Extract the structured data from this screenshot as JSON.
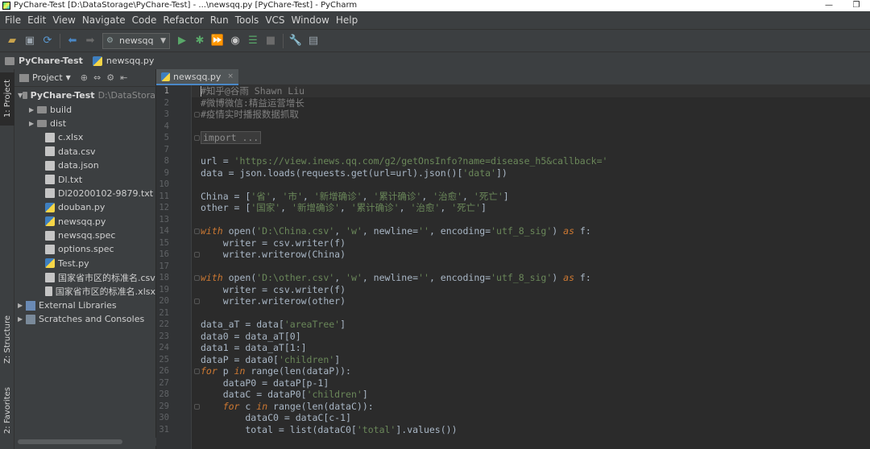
{
  "window": {
    "title": "PyChare-Test [D:\\DataStorage\\PyChare-Test] - ...\\newsqq.py [PyChare-Test] - PyCharm",
    "minimize_glyph": "—",
    "restore_glyph": "❐"
  },
  "menu": [
    "File",
    "Edit",
    "View",
    "Navigate",
    "Code",
    "Refactor",
    "Run",
    "Tools",
    "VCS",
    "Window",
    "Help"
  ],
  "toolbar": {
    "run_config": "newsqq",
    "icons": [
      "open-folder-icon",
      "save-icon",
      "sync-icon",
      "back-icon",
      "forward-icon",
      "run-icon",
      "debug-icon",
      "run-coverage-icon",
      "profile-icon",
      "concurrency-icon",
      "stop-icon",
      "settings-icon",
      "structure-icon"
    ]
  },
  "navbar": {
    "project": "PyChare-Test",
    "file": "newsqq.py"
  },
  "left_tabs": {
    "project": "1: Project",
    "structure": "Z: Structure",
    "favorites": "2: Favorites"
  },
  "project_panel": {
    "view_label": "Project",
    "root": {
      "name": "PyChare-Test",
      "path": "D:\\DataStora"
    },
    "items": [
      {
        "name": "build",
        "type": "folder"
      },
      {
        "name": "dist",
        "type": "folder"
      },
      {
        "name": "c.xlsx",
        "type": "file"
      },
      {
        "name": "data.csv",
        "type": "file"
      },
      {
        "name": "data.json",
        "type": "file"
      },
      {
        "name": "Dl.txt",
        "type": "file"
      },
      {
        "name": "Dl20200102-9879.txt",
        "type": "file"
      },
      {
        "name": "douban.py",
        "type": "py"
      },
      {
        "name": "newsqq.py",
        "type": "py"
      },
      {
        "name": "newsqq.spec",
        "type": "file"
      },
      {
        "name": "options.spec",
        "type": "file"
      },
      {
        "name": "Test.py",
        "type": "py"
      },
      {
        "name": "国家省市区的标准名.csv",
        "type": "file"
      },
      {
        "name": "国家省市区的标准名.xlsx",
        "type": "file"
      }
    ],
    "external_libraries": "External Libraries",
    "scratches": "Scratches and Consoles"
  },
  "tab": {
    "label": "newsqq.py",
    "close": "×"
  },
  "code": [
    {
      "n": "1",
      "tokens": [
        [
          "cmt",
          "#知乎@谷雨 Shawn Liu"
        ]
      ]
    },
    {
      "n": "2",
      "tokens": [
        [
          "cmt",
          "#微博微信:精益运营增长"
        ]
      ]
    },
    {
      "n": "3",
      "tokens": [
        [
          "cmt",
          "#疫情实时播报数据抓取"
        ]
      ]
    },
    {
      "n": "4",
      "tokens": []
    },
    {
      "n": "5",
      "tokens": [
        [
          "fold",
          "import ..."
        ]
      ]
    },
    {
      "n": "7",
      "tokens": []
    },
    {
      "n": "8",
      "tokens": [
        [
          "txt",
          "url = "
        ],
        [
          "str",
          "'https://view.inews.qq.com/g2/getOnsInfo?name=disease_h5&callback='"
        ]
      ]
    },
    {
      "n": "9",
      "tokens": [
        [
          "txt",
          "data = json.loads(requests.get(url=url).json()["
        ],
        [
          "str",
          "'data'"
        ],
        [
          "txt",
          "])"
        ]
      ]
    },
    {
      "n": "10",
      "tokens": []
    },
    {
      "n": "11",
      "tokens": [
        [
          "txt",
          "China = ["
        ],
        [
          "str",
          "'省'"
        ],
        [
          "txt",
          ", "
        ],
        [
          "str",
          "'市'"
        ],
        [
          "txt",
          ", "
        ],
        [
          "str",
          "'新增确诊'"
        ],
        [
          "txt",
          ", "
        ],
        [
          "str",
          "'累计确诊'"
        ],
        [
          "txt",
          ", "
        ],
        [
          "str",
          "'治愈'"
        ],
        [
          "txt",
          ", "
        ],
        [
          "str",
          "'死亡'"
        ],
        [
          "txt",
          "]"
        ]
      ]
    },
    {
      "n": "12",
      "tokens": [
        [
          "txt",
          "other = ["
        ],
        [
          "str",
          "'国家'"
        ],
        [
          "txt",
          ", "
        ],
        [
          "str",
          "'新增确诊'"
        ],
        [
          "txt",
          ", "
        ],
        [
          "str",
          "'累计确诊'"
        ],
        [
          "txt",
          ", "
        ],
        [
          "str",
          "'治愈'"
        ],
        [
          "txt",
          ", "
        ],
        [
          "str",
          "'死亡'"
        ],
        [
          "txt",
          "]"
        ]
      ]
    },
    {
      "n": "13",
      "tokens": []
    },
    {
      "n": "14",
      "tokens": [
        [
          "kw",
          "with"
        ],
        [
          "txt",
          " open("
        ],
        [
          "str",
          "'D:\\China.csv'"
        ],
        [
          "txt",
          ", "
        ],
        [
          "str",
          "'w'"
        ],
        [
          "txt",
          ", newline="
        ],
        [
          "str",
          "''"
        ],
        [
          "txt",
          ", encoding="
        ],
        [
          "str",
          "'utf_8_sig'"
        ],
        [
          "txt",
          ") "
        ],
        [
          "kw",
          "as"
        ],
        [
          "txt",
          " f:"
        ]
      ]
    },
    {
      "n": "15",
      "tokens": [
        [
          "txt",
          "    writer = csv.writer(f)"
        ]
      ]
    },
    {
      "n": "16",
      "tokens": [
        [
          "txt",
          "    writer.writerow(China)"
        ]
      ]
    },
    {
      "n": "17",
      "tokens": []
    },
    {
      "n": "18",
      "tokens": [
        [
          "kw",
          "with"
        ],
        [
          "txt",
          " open("
        ],
        [
          "str",
          "'D:\\other.csv'"
        ],
        [
          "txt",
          ", "
        ],
        [
          "str",
          "'w'"
        ],
        [
          "txt",
          ", newline="
        ],
        [
          "str",
          "''"
        ],
        [
          "txt",
          ", encoding="
        ],
        [
          "str",
          "'utf_8_sig'"
        ],
        [
          "txt",
          ") "
        ],
        [
          "kw",
          "as"
        ],
        [
          "txt",
          " f:"
        ]
      ]
    },
    {
      "n": "19",
      "tokens": [
        [
          "txt",
          "    writer = csv.writer(f)"
        ]
      ]
    },
    {
      "n": "20",
      "tokens": [
        [
          "txt",
          "    writer.writerow(other)"
        ]
      ]
    },
    {
      "n": "21",
      "tokens": []
    },
    {
      "n": "22",
      "tokens": [
        [
          "txt",
          "data_aT = data["
        ],
        [
          "str",
          "'areaTree'"
        ],
        [
          "txt",
          "]"
        ]
      ]
    },
    {
      "n": "23",
      "tokens": [
        [
          "txt",
          "data0 = data_aT[0]"
        ]
      ]
    },
    {
      "n": "24",
      "tokens": [
        [
          "txt",
          "data1 = data_aT[1:]"
        ]
      ]
    },
    {
      "n": "25",
      "tokens": [
        [
          "txt",
          "dataP = data0["
        ],
        [
          "str",
          "'children'"
        ],
        [
          "txt",
          "]"
        ]
      ]
    },
    {
      "n": "26",
      "tokens": [
        [
          "kw",
          "for"
        ],
        [
          "txt",
          " p "
        ],
        [
          "kw",
          "in"
        ],
        [
          "txt",
          " range(len(dataP)):"
        ]
      ]
    },
    {
      "n": "27",
      "tokens": [
        [
          "txt",
          "    dataP0 = dataP[p-1]"
        ]
      ]
    },
    {
      "n": "28",
      "tokens": [
        [
          "txt",
          "    dataC = dataP0["
        ],
        [
          "str",
          "'children'"
        ],
        [
          "txt",
          "]"
        ]
      ]
    },
    {
      "n": "29",
      "tokens": [
        [
          "txt",
          "    "
        ],
        [
          "kw",
          "for"
        ],
        [
          "txt",
          " c "
        ],
        [
          "kw",
          "in"
        ],
        [
          "txt",
          " range(len(dataC)):"
        ]
      ]
    },
    {
      "n": "30",
      "tokens": [
        [
          "txt",
          "        dataC0 = dataC[c-1]"
        ]
      ]
    },
    {
      "n": "31",
      "tokens": [
        [
          "txt",
          "        total = list(dataC0["
        ],
        [
          "str",
          "'total'"
        ],
        [
          "txt",
          "].values())"
        ]
      ]
    }
  ]
}
